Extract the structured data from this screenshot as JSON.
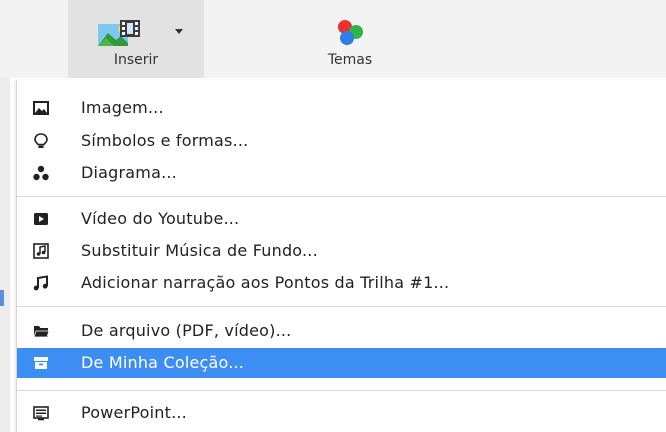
{
  "toolbar": {
    "insert_label": "Inserir",
    "themes_label": "Temas",
    "insert_icon": "image-film-icon",
    "themes_icon": "color-balls-icon"
  },
  "menu": {
    "groups": [
      {
        "items": [
          {
            "label": "Imagem...",
            "icon": "image-icon"
          },
          {
            "label": "Símbolos e formas...",
            "icon": "lightbulb-icon"
          },
          {
            "label": "Diagrama...",
            "icon": "diagram-icon"
          }
        ]
      },
      {
        "items": [
          {
            "label": "Vídeo do Youtube...",
            "icon": "play-icon"
          },
          {
            "label": "Substituir Música de Fundo...",
            "icon": "music-file-icon"
          },
          {
            "label": "Adicionar narração aos Pontos da Trilha #1...",
            "icon": "music-note-icon"
          }
        ]
      },
      {
        "items": [
          {
            "label": "De arquivo (PDF, vídeo)...",
            "icon": "folder-icon"
          },
          {
            "label": "De Minha Coleção...",
            "icon": "collection-icon",
            "selected": true
          }
        ]
      },
      {
        "items": [
          {
            "label": "PowerPoint...",
            "icon": "powerpoint-icon"
          }
        ]
      }
    ]
  },
  "colors": {
    "selected_bg": "#3d8ef3",
    "selected_text": "#ffffff",
    "text": "#222222",
    "toolbar_bg": "#f3f3f3",
    "insert_active_bg": "#e2e2e2"
  }
}
